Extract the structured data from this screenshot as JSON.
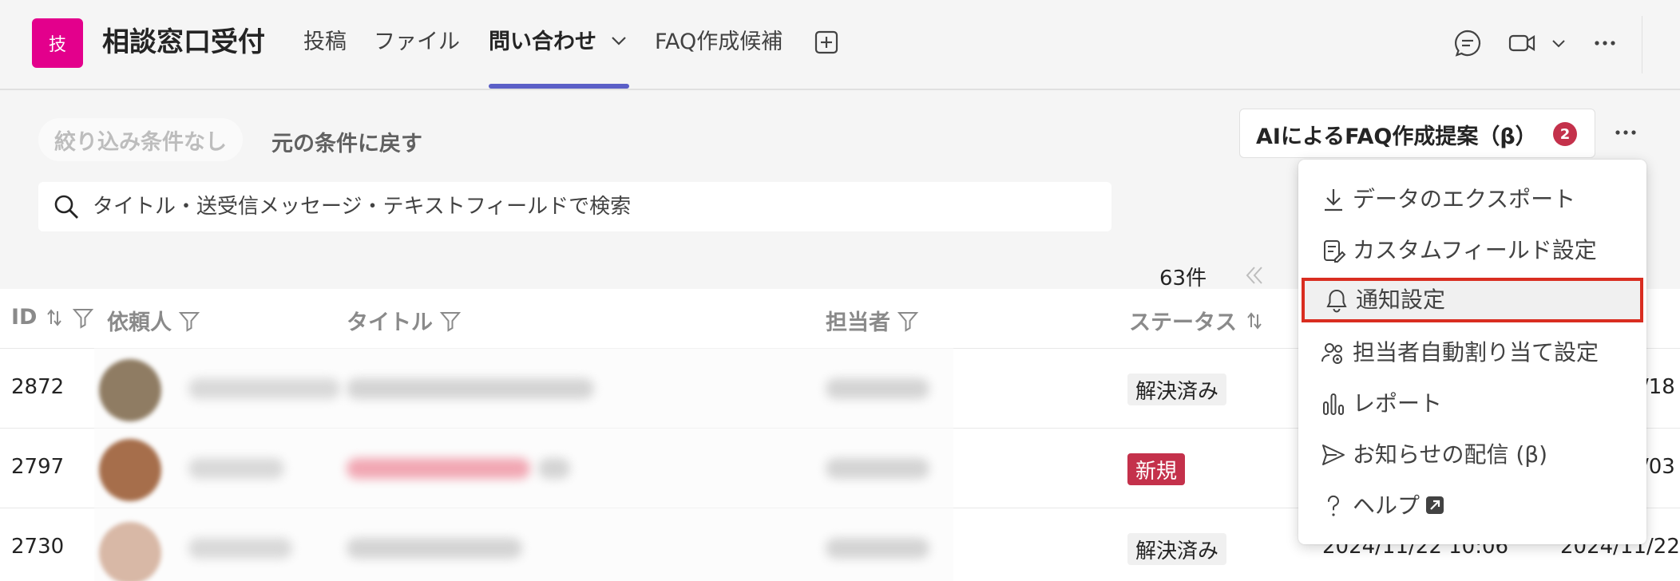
{
  "app": {
    "icon_text": "技",
    "title": "相談窓口受付"
  },
  "tabs": [
    {
      "label": "投稿"
    },
    {
      "label": "ファイル"
    },
    {
      "label": "問い合わせ"
    },
    {
      "label": "FAQ作成候補"
    }
  ],
  "icons": {
    "chat": "chat-icon",
    "video": "video-icon",
    "chevron": "chevron-down-icon",
    "more": "more-icon",
    "add": "add-tab-icon",
    "search": "search-icon"
  },
  "toolbar": {
    "filter_none": "絞り込み条件なし",
    "reset": "元の条件に戻す",
    "search_placeholder": "タイトル・送受信メッセージ・テキストフィールドで検索",
    "ai_button": "AIによるFAQ作成提案（β）",
    "ai_badge": "2",
    "count": "63件"
  },
  "table": {
    "headers": [
      "ID",
      "依頼人",
      "タイトル",
      "担当者",
      "ステータス"
    ],
    "rows": [
      {
        "id": "2872",
        "status": "解決済み",
        "status_type": "done",
        "date": "",
        "date2": "/18"
      },
      {
        "id": "2797",
        "status": "新規",
        "status_type": "new",
        "date": "",
        "date2": "/03"
      },
      {
        "id": "2730",
        "status": "解決済み",
        "status_type": "done",
        "date": "2024/11/22 10:06",
        "date2": "2024/11/22"
      }
    ]
  },
  "menu": {
    "items": [
      {
        "label": "データのエクスポート",
        "icon": "download-icon"
      },
      {
        "label": "カスタムフィールド設定",
        "icon": "form-edit-icon"
      },
      {
        "label": "通知設定",
        "icon": "bell-icon",
        "selected": true
      },
      {
        "label": "担当者自動割り当て設定",
        "icon": "people-settings-icon"
      },
      {
        "label": "レポート",
        "icon": "bar-chart-icon"
      },
      {
        "label": "お知らせの配信 (β)",
        "icon": "send-icon"
      },
      {
        "label": "ヘルプ",
        "icon": "question-icon"
      }
    ]
  },
  "colors": {
    "accent": "#5b5fc7",
    "app_icon": "#e3008c",
    "badge": "#c4314b",
    "highlight": "#d92d20"
  }
}
